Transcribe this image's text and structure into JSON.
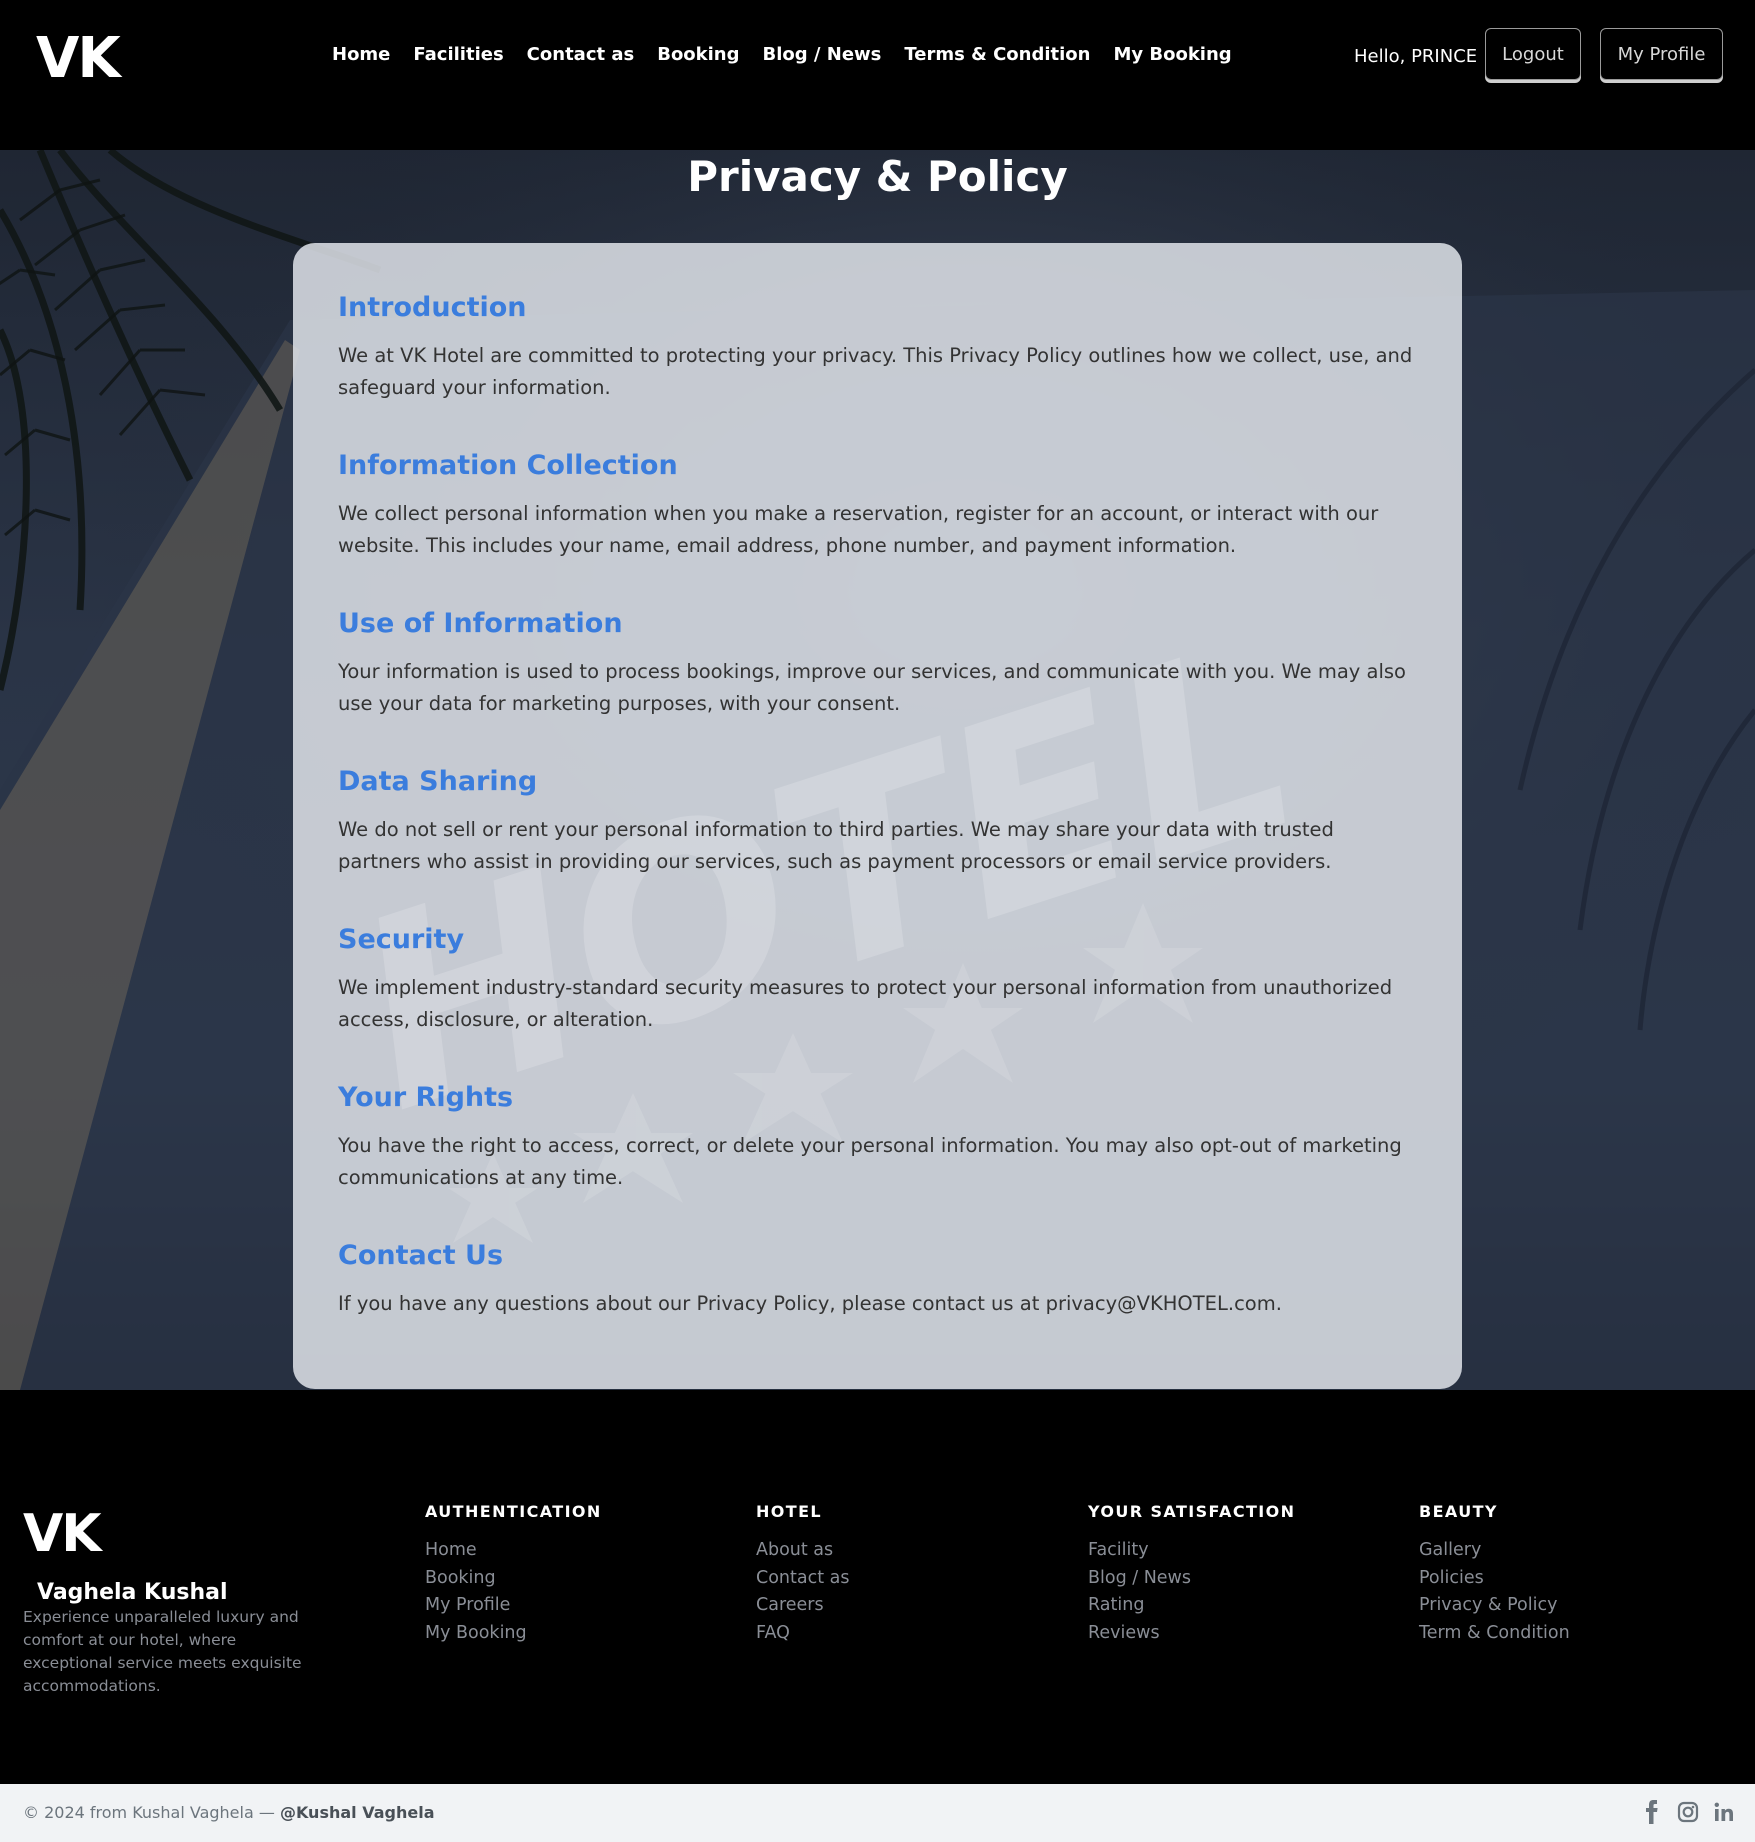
{
  "header": {
    "logo": "VK",
    "nav": [
      "Home",
      "Facilities",
      "Contact as",
      "Booking",
      "Blog / News",
      "Terms & Condition",
      "My Booking"
    ],
    "greeting": "Hello, PRINCE",
    "logout_label": "Logout",
    "profile_label": "My Profile"
  },
  "main": {
    "title": "Privacy & Policy",
    "watermark_text": "HOTEL",
    "sections": [
      {
        "title": "Introduction",
        "text": "We at VK Hotel are committed to protecting your privacy. This Privacy Policy outlines how we collect, use, and safeguard your information."
      },
      {
        "title": "Information Collection",
        "text": "We collect personal information when you make a reservation, register for an account, or interact with our website. This includes your name, email address, phone number, and payment information."
      },
      {
        "title": "Use of Information",
        "text": "Your information is used to process bookings, improve our services, and communicate with you. We may also use your data for marketing purposes, with your consent."
      },
      {
        "title": "Data Sharing",
        "text": "We do not sell or rent your personal information to third parties. We may share your data with trusted partners who assist in providing our services, such as payment processors or email service providers."
      },
      {
        "title": "Security",
        "text": "We implement industry-standard security measures to protect your personal information from unauthorized access, disclosure, or alteration."
      },
      {
        "title": "Your Rights",
        "text": "You have the right to access, correct, or delete your personal information. You may also opt-out of marketing communications at any time."
      },
      {
        "title": "Contact Us",
        "text": "If you have any questions about our Privacy Policy, please contact us at privacy@VKHOTEL.com."
      }
    ]
  },
  "footer": {
    "logo": "VK",
    "name": "Vaghela Kushal",
    "description": "Experience unparalleled luxury and comfort at our hotel, where exceptional service meets exquisite accommodations.",
    "columns": [
      {
        "heading": "AUTHENTICATION",
        "links": [
          "Home",
          "Booking",
          "My Profile",
          "My Booking"
        ]
      },
      {
        "heading": "HOTEL",
        "links": [
          "About as",
          "Contact as",
          "Careers",
          "FAQ"
        ]
      },
      {
        "heading": "YOUR SATISFACTION",
        "links": [
          "Facility",
          "Blog / News",
          "Rating",
          "Reviews"
        ]
      },
      {
        "heading": "BEAUTY",
        "links": [
          "Gallery",
          "Policies",
          "Privacy & Policy",
          "Term & Condition"
        ]
      }
    ],
    "copyright": "© 2024 from Kushal Vaghela — ",
    "handle": "@Kushal Vaghela",
    "socials": [
      "facebook-icon",
      "instagram-icon",
      "linkedin-icon"
    ]
  },
  "colors": {
    "accent": "#3b7ddd",
    "header_bg": "#000000",
    "card_bg": "#e4e7ed"
  }
}
